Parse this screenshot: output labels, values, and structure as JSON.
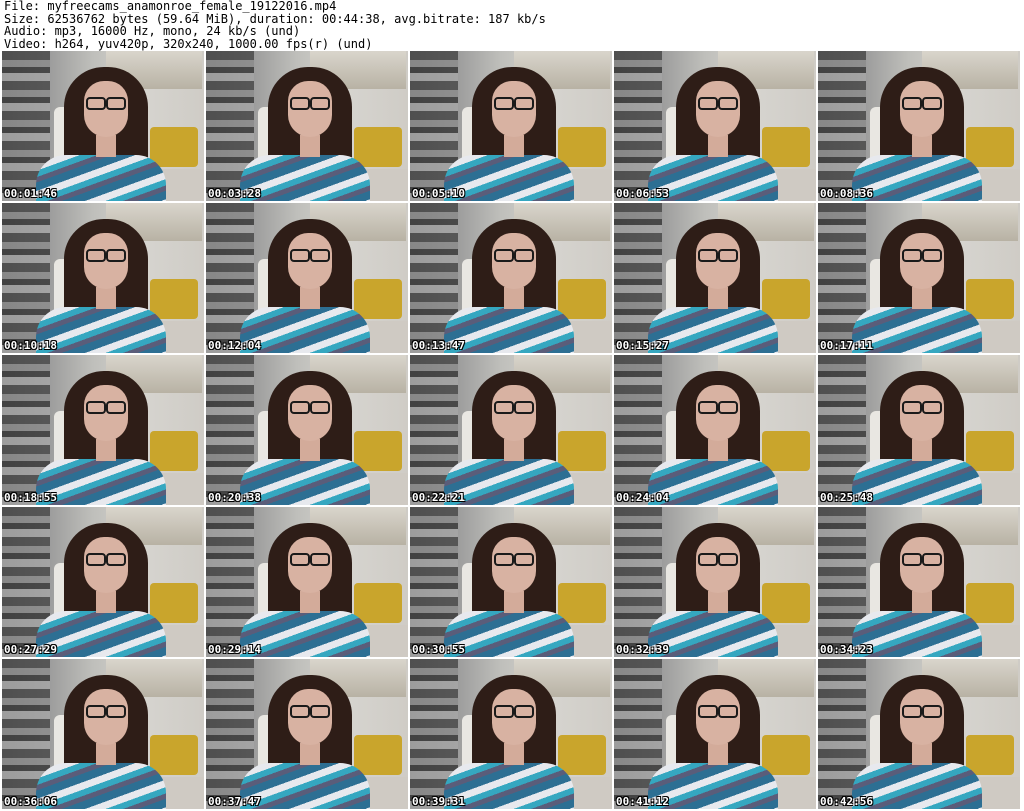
{
  "header": {
    "file_line": "File: myfreecams_anamonroe_female_19122016.mp4",
    "size_line": "Size: 62536762 bytes (59.64 MiB), duration: 00:44:38, avg.bitrate: 187 kb/s",
    "audio_line": "Audio: mp3, 16000 Hz, mono, 24 kb/s (und)",
    "video_line": "Video: h264, yuv420p, 320x240, 1000.00 fps(r) (und)"
  },
  "thumbnails": [
    "00:01:46",
    "00:03:28",
    "00:05:10",
    "00:06:53",
    "00:08:36",
    "00:10:18",
    "00:12:04",
    "00:13:47",
    "00:15:27",
    "00:17:11",
    "00:18:55",
    "00:20:38",
    "00:22:21",
    "00:24:04",
    "00:25:48",
    "00:27:29",
    "00:29:14",
    "00:30:55",
    "00:32:39",
    "00:34:23",
    "00:36:06",
    "00:37:47",
    "00:39:31",
    "00:41:12",
    "00:42:56"
  ]
}
